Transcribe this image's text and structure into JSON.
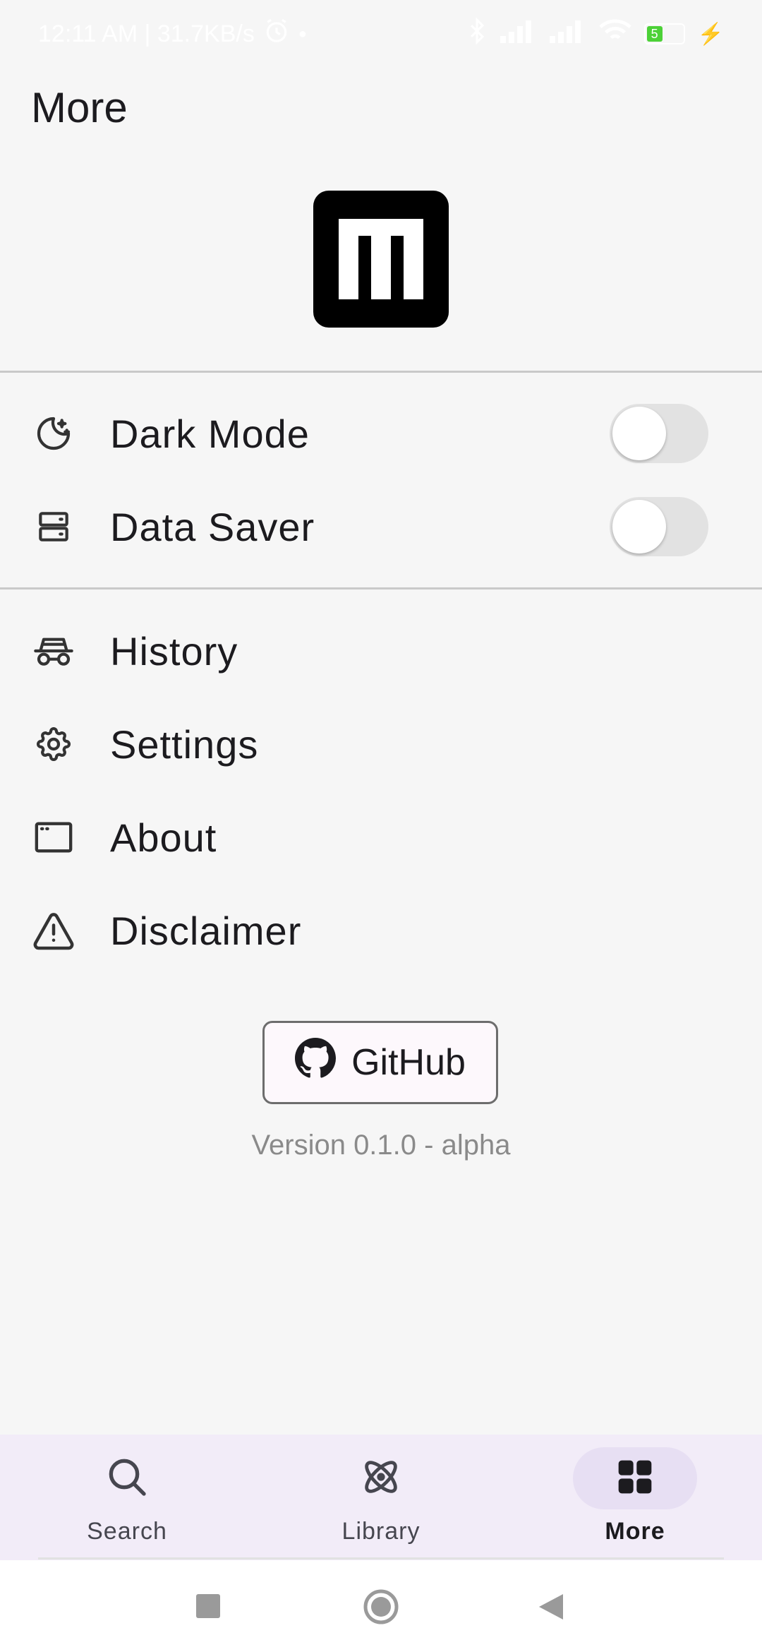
{
  "status_bar": {
    "time": "12:11 AM | 31.7KB/s",
    "battery": "5"
  },
  "page": {
    "title": "More"
  },
  "toggles": [
    {
      "label": "Dark Mode",
      "icon": "moon-stars-icon",
      "on": false
    },
    {
      "label": "Data Saver",
      "icon": "storage-icon",
      "on": false
    }
  ],
  "menu": [
    {
      "label": "History",
      "icon": "incognito-icon"
    },
    {
      "label": "Settings",
      "icon": "gear-icon"
    },
    {
      "label": "About",
      "icon": "window-icon"
    },
    {
      "label": "Disclaimer",
      "icon": "warning-icon"
    }
  ],
  "github_button": {
    "label": "GitHub"
  },
  "version": "Version 0.1.0 - alpha",
  "bottom_nav": [
    {
      "label": "Search",
      "icon": "search-icon",
      "active": false
    },
    {
      "label": "Library",
      "icon": "atom-icon",
      "active": false
    },
    {
      "label": "More",
      "icon": "grid-icon",
      "active": true
    }
  ],
  "colors": {
    "background": "#f6f6f6",
    "nav_background": "#f2ecf8",
    "active_pill": "#e7dff3",
    "battery_green": "#4cd137"
  }
}
